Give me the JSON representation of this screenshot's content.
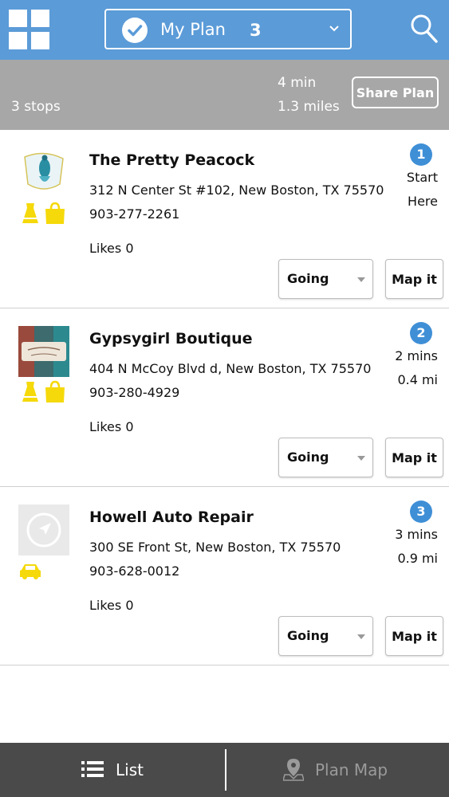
{
  "header": {
    "plan_label": "My Plan",
    "plan_count": "3",
    "icons": [
      "grid-icon",
      "check-circle-icon",
      "chevron-down-icon",
      "search-icon"
    ]
  },
  "summary": {
    "stops": "3 stops",
    "time": "4 min",
    "distance": "1.3 miles",
    "share_label": "Share Plan"
  },
  "stops": [
    {
      "number": "1",
      "name": "The Pretty Peacock",
      "address": "312 N Center St #102, New Boston, TX 75570",
      "phone": "903-277-2261",
      "likes": "Likes 0",
      "dist_line1": "Start",
      "dist_line2": "Here",
      "going": "Going",
      "map_label": "Map it",
      "categories": [
        "dress-icon",
        "shopping-bag-icon"
      ]
    },
    {
      "number": "2",
      "name": "Gypsygirl Boutique",
      "address": "404 N McCoy Blvd d, New Boston, TX 75570",
      "phone": "903-280-4929",
      "likes": "Likes 0",
      "dist_line1": "2 mins",
      "dist_line2": "0.4 mi",
      "going": "Going",
      "map_label": "Map it",
      "categories": [
        "dress-icon",
        "shopping-bag-icon"
      ]
    },
    {
      "number": "3",
      "name": "Howell Auto Repair",
      "address": "300 SE Front St, New Boston, TX 75570",
      "phone": "903-628-0012",
      "likes": "Likes 0",
      "dist_line1": "3 mins",
      "dist_line2": "0.9 mi",
      "going": "Going",
      "map_label": "Map it",
      "categories": [
        "car-icon"
      ]
    }
  ],
  "bottom": {
    "list_label": "List",
    "map_label": "Plan Map"
  },
  "colors": {
    "header": "#5b9bd8",
    "summary": "#a7a7a7",
    "badge": "#3f8fd6",
    "category": "#f5d90a",
    "bottom": "#4a4a4a"
  }
}
